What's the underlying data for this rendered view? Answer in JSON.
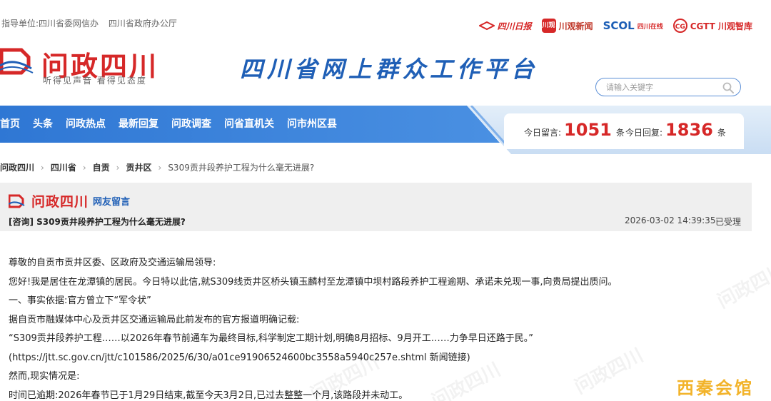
{
  "header": {
    "guide": [
      "指导单位:四川省委网信办",
      "四川省政府办公厅"
    ],
    "partners": {
      "sc_daily": "四川日报",
      "cg_icon": "川观",
      "cg_news": "川观新闻",
      "scol": "SCOL",
      "scol_sub": "四川在线",
      "cgtt_icon": "CG",
      "cgtt": "CGTT 川观智库"
    },
    "logo_title": "问政四川",
    "logo_slogan": "听得见声音  看得见态度",
    "platform_title": "四川省网上群众工作平台",
    "search_placeholder": "请输入关键字"
  },
  "nav": [
    "首页",
    "头条",
    "问政热点",
    "最新回复",
    "问政调查",
    "问省直机关",
    "问市州区县"
  ],
  "stats": {
    "today_msg_label": "今日留言:",
    "today_msg_value": "1051",
    "today_reply_label": "今日回复:",
    "today_reply_value": "1836",
    "unit": "条"
  },
  "breadcrumb": [
    "问政四川",
    "四川省",
    "自贡",
    "贡井区"
  ],
  "breadcrumb_current": "S309贡井段养护工程为什么毫无进展?",
  "panel": {
    "brand": "问政四川",
    "section": "网友留言",
    "title": "[咨询] S309贡井段养护工程为什么毫无进展?",
    "time": "2026-03-02 14:39:35",
    "status": "已受理"
  },
  "body": [
    "尊敬的自贡市贡井区委、区政府及交通运输局领导:",
    "您好!我是居住在龙潭镇的居民。今日特以此信,就S309线贡井区桥头镇玉麟村至龙潭镇中坝村路段养护工程逾期、承诺未兑现一事,向贵局提出质问。",
    "一、事实依据:官方曾立下“军令状”",
    "据自贡市融媒体中心及贡井区交通运输局此前发布的官方报道明确记载:",
    "“S309贡井段养护工程……以2026年春节前通车为最终目标,科学制定工期计划,明确8月招标、9月开工……力争早日还路于民。”",
    "(https://jtt.sc.gov.cn/jtt/c101586/2025/6/30/a01ce91906524600bc3558a5940c257e.shtml 新闻链接)",
    "然而,现实情况是:",
    "时间已逾期:2026年春节已于1月29日结束,截至今天3月2日,已过去整整一个月,该路段并未动工。"
  ],
  "watermark": "问政四川",
  "corner_watermark": "西秦会馆",
  "colors": {
    "brand_red": "#d62828",
    "brand_blue": "#1f5fb6",
    "nav_blue": "#3a7fd6"
  }
}
